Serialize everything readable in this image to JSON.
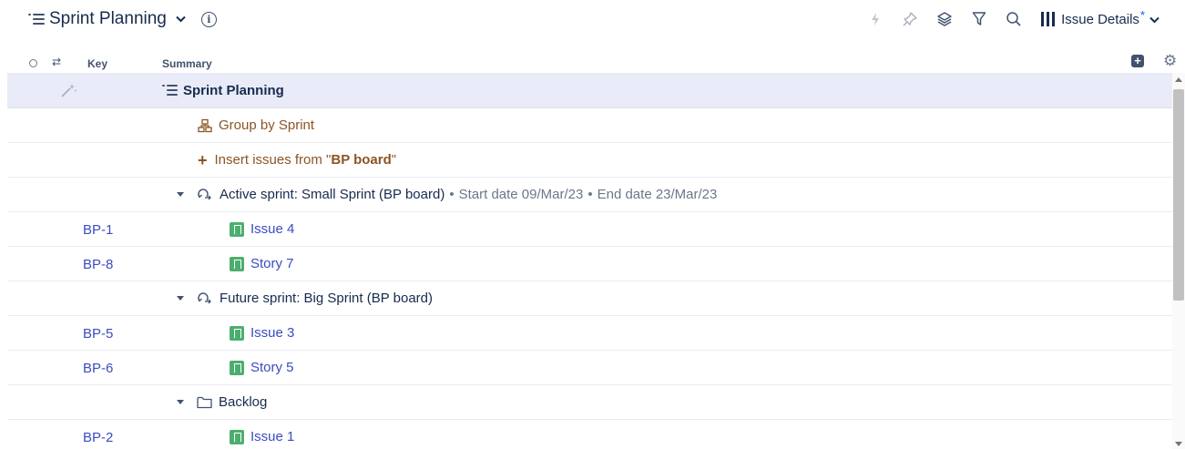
{
  "header": {
    "title": "Sprint Planning",
    "info_glyph": "i",
    "view_label": "Issue Details",
    "view_modified_mark": "*",
    "icons": [
      "automation-bolt-icon",
      "pin-icon",
      "layers-icon",
      "filter-icon",
      "search-icon",
      "columns-icon"
    ]
  },
  "columns": {
    "key": "Key",
    "summary": "Summary",
    "arrows_glyph": "⇄",
    "add_glyph": "+",
    "settings_glyph": "⚙"
  },
  "rows": {
    "root": {
      "summary": "Sprint Planning"
    },
    "group": {
      "summary": "Group by Sprint"
    },
    "insert": {
      "prefix": "Insert issues from \"",
      "board": "BP board",
      "suffix": "\""
    },
    "sprint1": {
      "summary": "Active sprint: Small Sprint (BP board)",
      "start": "Start date 09/Mar/23",
      "end": "End date 23/Mar/23",
      "separator": "•"
    },
    "bp1": {
      "key": "BP-1",
      "summary": "Issue 4"
    },
    "bp8": {
      "key": "BP-8",
      "summary": "Story 7"
    },
    "sprint2": {
      "summary": "Future sprint: Big Sprint (BP board)"
    },
    "bp5": {
      "key": "BP-5",
      "summary": "Issue 3"
    },
    "bp6": {
      "key": "BP-6",
      "summary": "Story 5"
    },
    "backlog": {
      "summary": "Backlog"
    },
    "bp2": {
      "key": "BP-2",
      "summary": "Issue 1"
    }
  },
  "colors": {
    "accent_blue": "#3b4cc0",
    "generator_brown": "#8b5524",
    "story_green": "#4cae6e",
    "selected_row": "#e9ecf8",
    "modified_asterisk": "#0065ff"
  }
}
